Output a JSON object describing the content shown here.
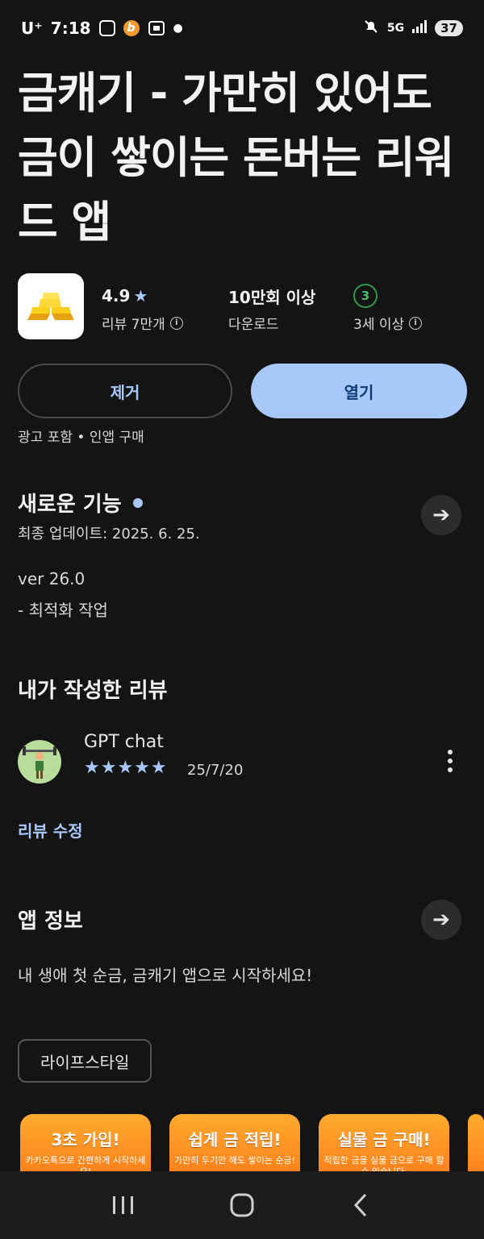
{
  "status_bar": {
    "carrier": "U⁺",
    "time": "7:18",
    "network": "5G",
    "battery": "37"
  },
  "app": {
    "title": "금캐기 - 가만히 있어도 금이 쌓이는 돈버는 리워드 앱",
    "rating": "4.9",
    "reviews_label": "리뷰 7만개",
    "downloads": "10만회 이상",
    "downloads_label": "다운로드",
    "age_rating": "3",
    "age_label": "3세 이상"
  },
  "actions": {
    "remove_label": "제거",
    "open_label": "열기",
    "ads_note": "광고 포함 • 인앱 구매"
  },
  "whats_new": {
    "title": "새로운 기능",
    "updated": "최종 업데이트: 2025. 6. 25.",
    "version": "ver 26.0",
    "notes": "- 최적화 작업"
  },
  "my_review": {
    "title": "내가 작성한 리뷰",
    "reviewer": "GPT chat",
    "stars": "★★★★★",
    "rating": 5,
    "date": "25/7/20",
    "edit_label": "리뷰 수정"
  },
  "app_info": {
    "title": "앱 정보",
    "description": "내 생애 첫 순금, 금캐기 앱으로 시작하세요!",
    "category": "라이프스타일"
  },
  "screenshots": [
    {
      "title": "3초 가입!",
      "subtitle": "카카오톡으로 간편하게 시작하세요!"
    },
    {
      "title": "쉽게 금 적립!",
      "subtitle": "가만히 두기만 해도 쌓이는 순금!"
    },
    {
      "title": "실물 금 구매!",
      "subtitle": "적립한 금을 실물 금으로 구매 할 수 있습니다."
    }
  ],
  "colors": {
    "background": "#141414",
    "accent": "#a8c8fa",
    "open_button_text": "#0d3b73",
    "age_badge": "#2d9b4a",
    "screenshot_orange": "#ff8f22"
  }
}
